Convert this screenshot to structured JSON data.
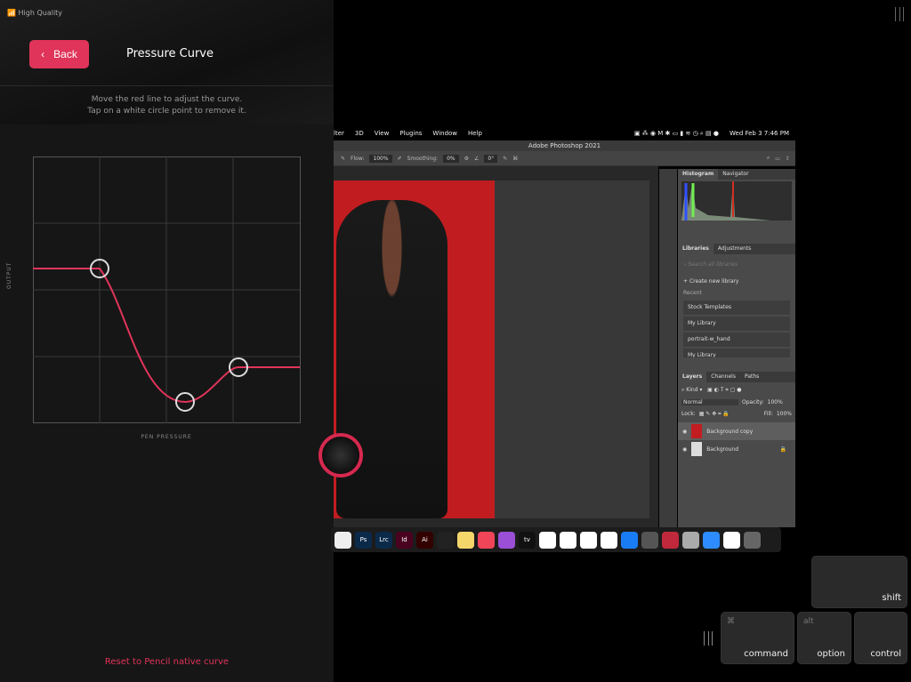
{
  "left_panel": {
    "status": "High Quality",
    "back_label": "Back",
    "title": "Pressure Curve",
    "instructions": [
      "Move the red line to adjust the curve.",
      "Tap on a white circle point to remove it."
    ],
    "y_axis_label": "OUTPUT",
    "x_axis_label": "PEN PRESSURE",
    "reset_label": "Reset to Pencil native curve",
    "accent": "#e0345a",
    "curve_points": [
      {
        "pressure": 0.25,
        "output": 0.58
      },
      {
        "pressure": 0.57,
        "output": 0.08
      },
      {
        "pressure": 0.77,
        "output": 0.21
      }
    ]
  },
  "photoshop": {
    "menu": [
      "lter",
      "3D",
      "View",
      "Plugins",
      "Window",
      "Help"
    ],
    "clock": "Wed Feb 3  7:46 PM",
    "title": "Adobe Photoshop 2021",
    "options": {
      "flow_label": "Flow:",
      "flow": "100%",
      "smoothing_label": "Smoothing:",
      "smoothing": "0%",
      "angle": "0°"
    },
    "histogram_tabs": [
      "Histogram",
      "Navigator"
    ],
    "library_tabs": [
      "Libraries",
      "Adjustments"
    ],
    "search_placeholder": "Search all libraries",
    "create_library": "Create new library",
    "recent_label": "Recent",
    "libraries": [
      "Stock Templates",
      "My Library",
      "portrait-w_hand",
      "My Library"
    ],
    "layer_tabs": [
      "Layers",
      "Channels",
      "Paths"
    ],
    "kind": "Kind",
    "blend": "Normal",
    "opacity_label": "Opacity:",
    "opacity": "100%",
    "lock_label": "Lock:",
    "fill_label": "Fill:",
    "fill": "100%",
    "layers": [
      "Background copy",
      "Background"
    ]
  },
  "dock": [
    "Reminders",
    "Ps",
    "Lrc",
    "Id",
    "Ai",
    "Screenshot",
    "Notes",
    "Music",
    "Podcasts",
    "tv",
    "News",
    "Numbers",
    "Keynote",
    "Pages",
    "App Store",
    "System Preferences",
    "Astropad",
    "Font Book",
    "Zoom",
    "Sidecar",
    "Trash"
  ],
  "keys": {
    "shift": "shift",
    "command": "command",
    "command_symbol": "⌘",
    "option": "option",
    "option_symbol": "alt",
    "control": "control"
  }
}
